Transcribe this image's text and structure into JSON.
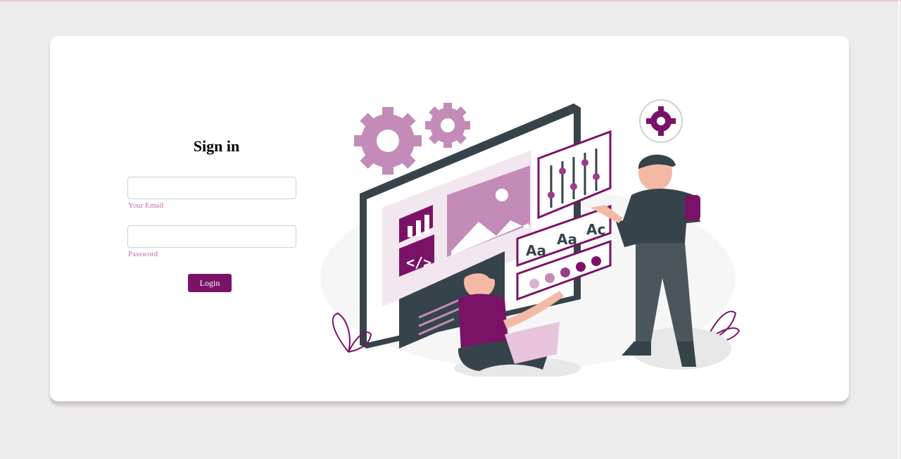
{
  "signin": {
    "title": "Sign in",
    "email_label": "Your Email",
    "email_value": "",
    "password_label": "Password",
    "password_value": "",
    "login_label": "Login"
  },
  "illustration": {
    "ui_text_1": "Aa",
    "ui_text_2": "Aa",
    "ui_text_3": "Ac"
  },
  "colors": {
    "accent": "#7a1367",
    "accent_light": "#c48bb8",
    "label": "#b96fa4",
    "background": "#edeced",
    "card": "#ffffff"
  }
}
